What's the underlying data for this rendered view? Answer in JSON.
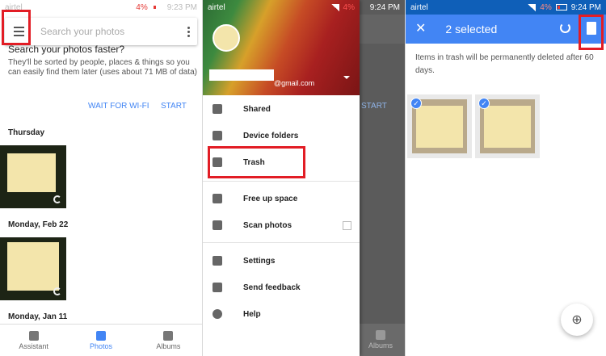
{
  "status": {
    "carrier": "airtel",
    "battery": "4%",
    "time_left": "9:23 PM",
    "time_mid": "9:24 PM",
    "time_right": "9:24 PM"
  },
  "photos_screen": {
    "search_placeholder": "Search your photos",
    "backup_title": "Search your photos faster?",
    "backup_desc": "They'll be sorted by people, places & things so you can easily find them later (uses about 71 MB of data)",
    "wait_wifi_label": "WAIT FOR WI-FI",
    "start_label": "START",
    "sections": [
      "Thursday",
      "Monday, Feb 22",
      "Monday, Jan 11"
    ],
    "nav": [
      {
        "label": "Assistant",
        "icon": "assistant-icon"
      },
      {
        "label": "Photos",
        "icon": "photos-icon",
        "active": true
      },
      {
        "label": "Albums",
        "icon": "albums-icon"
      }
    ]
  },
  "drawer": {
    "email_suffix": "@gmail.com",
    "items": [
      {
        "label": "Shared",
        "icon": "people-icon"
      },
      {
        "label": "Device folders",
        "icon": "folder-icon"
      },
      {
        "label": "Trash",
        "icon": "trash-icon"
      },
      {
        "label": "Free up space",
        "icon": "phone-icon"
      },
      {
        "label": "Scan photos",
        "icon": "scan-icon"
      },
      {
        "label": "Settings",
        "icon": "gear-icon"
      },
      {
        "label": "Send feedback",
        "icon": "feedback-icon"
      },
      {
        "label": "Help",
        "icon": "help-icon"
      }
    ],
    "behind_start": "START",
    "behind_albums": "Albums"
  },
  "trash_screen": {
    "title": "2 selected",
    "note": "Items in trash will be permanently deleted after 60 days."
  },
  "colors": {
    "accent": "#4285f4",
    "highlight": "#e21d25",
    "note": "#f3e5ab"
  }
}
